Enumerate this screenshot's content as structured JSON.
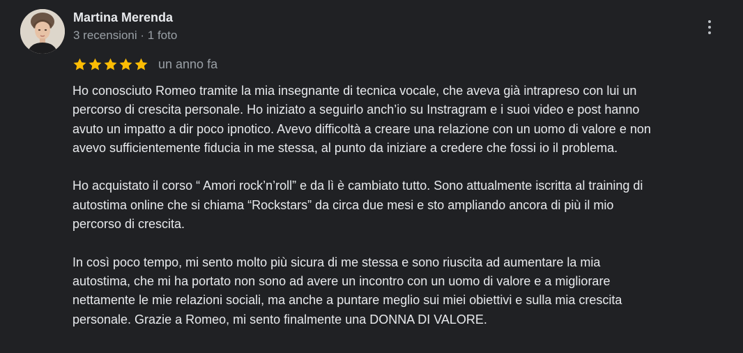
{
  "review": {
    "author": {
      "name": "Martina Merenda",
      "meta": "3 recensioni · 1 foto",
      "avatar_icon": "profile-photo"
    },
    "rating": {
      "stars": 5,
      "max_stars": 5,
      "star_color": "#fbbc04"
    },
    "date": "un anno fa",
    "paragraphs": [
      "Ho conosciuto Romeo tramite la mia insegnante di tecnica vocale, che aveva già intrapreso con lui un\npercorso di crescita personale. Ho iniziato a seguirlo anch’io su Instragram e i suoi video e post hanno\navuto un impatto a dir poco ipnotico. Avevo difficoltà a creare una relazione con un uomo di valore e non\navevo sufficientemente fiducia in me stessa, al punto da iniziare a credere che fossi io il problema.",
      "Ho acquistato il corso “ Amori rock’n’roll” e da lì è cambiato tutto. Sono attualmente iscritta al training di\nautostima online che si chiama “Rockstars” da circa due mesi e sto ampliando ancora di più il mio\npercorso di crescita.",
      "In così poco tempo, mi sento molto più sicura di me stessa e sono riuscita ad aumentare la mia\nautostima, che mi ha portato non sono ad avere un incontro con un uomo di valore e a migliorare\nnettamente le mie relazioni sociali, ma anche a puntare meglio sui miei obiettivi e sulla mia crescita\npersonale. Grazie a Romeo, mi sento finalmente una DONNA DI VALORE."
    ],
    "menu_icon": "more-vert-icon"
  },
  "theme": {
    "background": "#202124",
    "text_primary": "#e8eaed",
    "text_secondary": "#9aa0a6"
  }
}
